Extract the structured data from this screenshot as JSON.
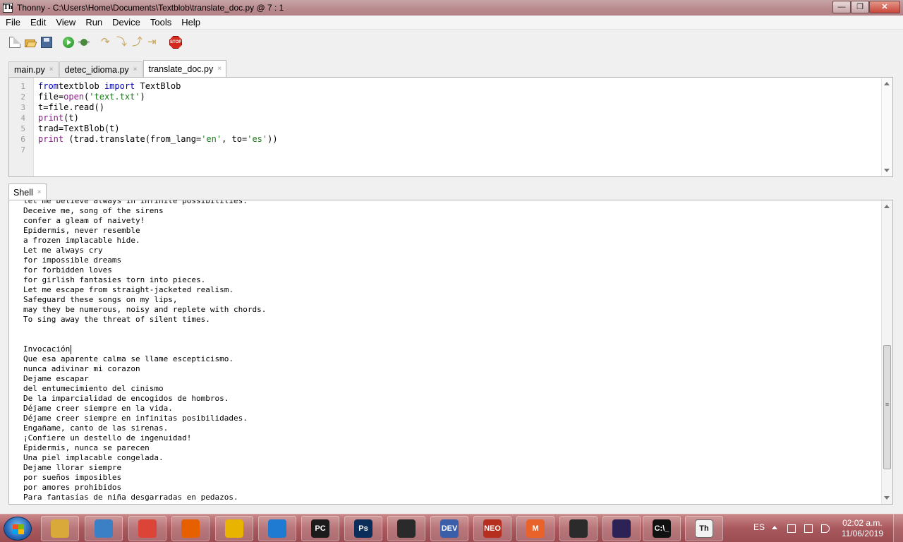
{
  "window": {
    "title": "Thonny  -  C:\\Users\\Home\\Documents\\Textblob\\translate_doc.py  @  7 : 1",
    "app_icon": "Th",
    "minimize": "—",
    "maximize": "❐",
    "close": "✕"
  },
  "menu": [
    "File",
    "Edit",
    "View",
    "Run",
    "Device",
    "Tools",
    "Help"
  ],
  "toolbar": {
    "icons": [
      "new-file-icon",
      "open-folder-icon",
      "save-icon",
      "run-icon",
      "debug-icon",
      "step-over-icon",
      "step-into-icon",
      "step-out-icon",
      "resume-icon",
      "stop-icon"
    ],
    "stop_label": "STOP",
    "step_glyph": "↷",
    "into_glyph": "⤵",
    "out_glyph": "⤴",
    "resume_glyph": "⇥"
  },
  "editor_tabs": [
    {
      "label": "main.py",
      "active": false
    },
    {
      "label": "detec_idioma.py",
      "active": false
    },
    {
      "label": "translate_doc.py",
      "active": true
    }
  ],
  "tab_close": "×",
  "editor": {
    "line_numbers": [
      "1",
      "2",
      "3",
      "4",
      "5",
      "6",
      "7"
    ],
    "lines": [
      [
        [
          "kw",
          "from"
        ],
        [
          "",
          "textblob "
        ],
        [
          "kw",
          "import"
        ],
        [
          "",
          " TextBlob"
        ]
      ],
      [
        [
          "",
          "file="
        ],
        [
          "bi",
          "open"
        ],
        [
          "",
          "("
        ],
        [
          "st",
          "'text.txt'"
        ],
        [
          "",
          ")"
        ]
      ],
      [
        [
          "",
          "t=file.read()"
        ]
      ],
      [
        [
          "bi",
          "print"
        ],
        [
          "",
          "(t)"
        ]
      ],
      [
        [
          "",
          "trad=TextBlob(t)"
        ]
      ],
      [
        [
          "bi",
          "print"
        ],
        [
          "",
          " (trad.translate(from_lang="
        ],
        [
          "st",
          "'en'"
        ],
        [
          "",
          ", to="
        ],
        [
          "st",
          "'es'"
        ],
        [
          "",
          "))"
        ]
      ],
      [
        [
          "",
          ""
        ]
      ]
    ]
  },
  "shell": {
    "tab_label": "Shell",
    "lines": [
      "let me believe always in infinite possibilities.",
      "Deceive me, song of the sirens",
      "confer a gleam of naivety!",
      "Epidermis, never resemble",
      "a frozen implacable hide.",
      "Let me always cry",
      "for impossible dreams",
      "for forbidden loves",
      "for girlish fantasies torn into pieces.",
      "Let me escape from straight-jacketed realism.",
      "Safeguard these songs on my lips,",
      "may they be numerous, noisy and replete with chords.",
      "To sing away the threat of silent times.",
      "",
      "",
      "Invocación",
      "Que esa aparente calma se llame escepticismo.",
      "nunca adivinar mi corazon",
      "Dejame escapar",
      "del entumecimiento del cinismo",
      "De la imparcialidad de encogidos de hombros.",
      "Déjame creer siempre en la vida.",
      "Déjame creer siempre en infinitas posibilidades.",
      "Engañame, canto de las sirenas.",
      "¡Confiere un destello de ingenuidad!",
      "Epidermis, nunca se parecen",
      "Una piel implacable congelada.",
      "Dejame llorar siempre",
      "por sueños imposibles",
      "por amores prohibidos",
      "Para fantasías de niña desgarradas en pedazos."
    ],
    "cursor_line": 15
  },
  "taskbar": {
    "apps": [
      {
        "name": "file-explorer-icon",
        "label": "",
        "color": "#d9a93a"
      },
      {
        "name": "media-player-icon",
        "label": "",
        "color": "#3b7fc4"
      },
      {
        "name": "chrome-icon",
        "label": "",
        "color": "#db4437"
      },
      {
        "name": "firefox-icon",
        "label": "",
        "color": "#e66000"
      },
      {
        "name": "winamp-icon",
        "label": "",
        "color": "#e8b400"
      },
      {
        "name": "vscode-icon",
        "label": "",
        "color": "#1f7ad2"
      },
      {
        "name": "pycharm-icon",
        "label": "PC",
        "color": "#1b1b1b"
      },
      {
        "name": "photoshop-icon",
        "label": "Ps",
        "color": "#0a2d5a"
      },
      {
        "name": "screen-capture-icon",
        "label": "",
        "color": "#2a2a2a"
      },
      {
        "name": "devcpp-icon",
        "label": "DEV",
        "color": "#3a5fa8"
      },
      {
        "name": "neo-icon",
        "label": "NEO",
        "color": "#b52e1e"
      },
      {
        "name": "mega-icon",
        "label": "M",
        "color": "#e8622a"
      },
      {
        "name": "avatar-app-icon",
        "label": "",
        "color": "#2b2b2b"
      },
      {
        "name": "eclipse-icon",
        "label": "",
        "color": "#2c2255"
      },
      {
        "name": "cmd-icon",
        "label": "C:\\_",
        "color": "#111111"
      },
      {
        "name": "thonny-icon",
        "label": "Th",
        "color": "#f2f2f2"
      }
    ],
    "lang": "ES",
    "time": "02:02 a.m.",
    "date": "11/06/2019"
  }
}
